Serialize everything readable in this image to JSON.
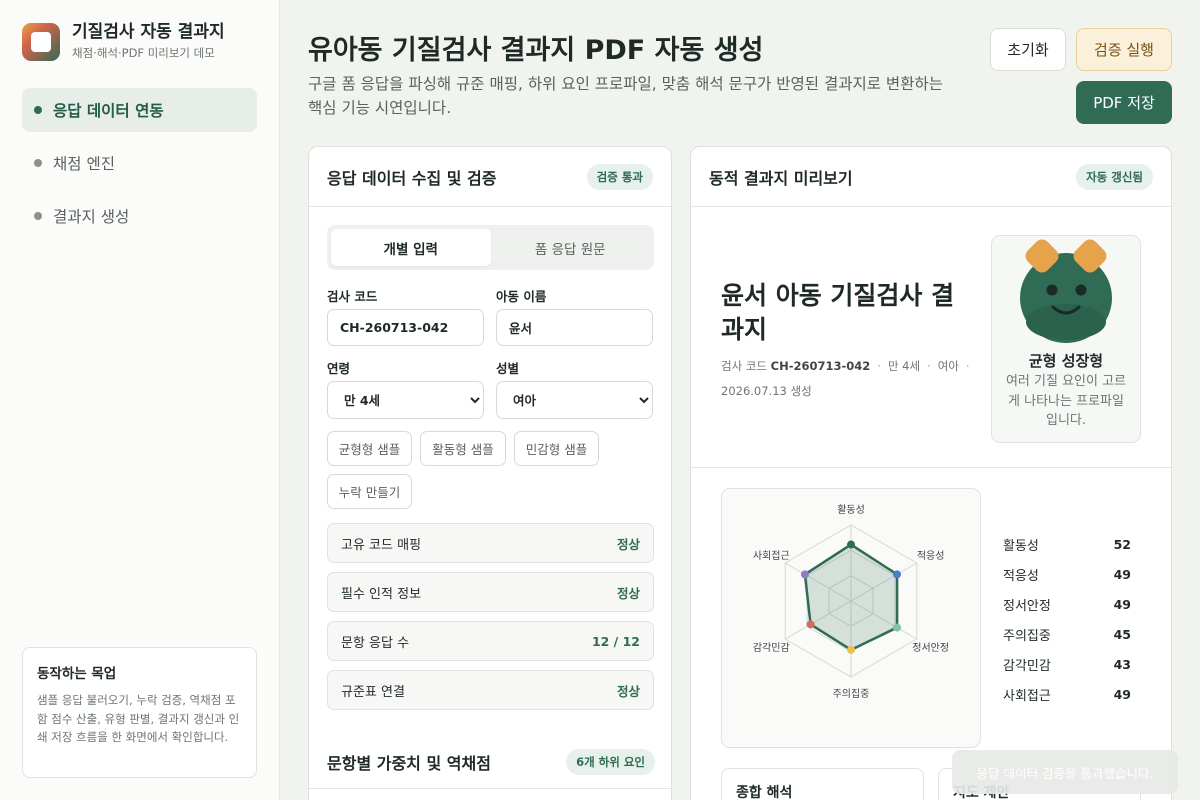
{
  "brand": {
    "title": "기질검사 자동 결과지",
    "subtitle": "채점·해석·PDF 미리보기 데모"
  },
  "nav": [
    {
      "label": "응답 데이터 연동",
      "active": true
    },
    {
      "label": "채점 엔진",
      "active": false
    },
    {
      "label": "결과지 생성",
      "active": false
    }
  ],
  "purpose": {
    "title": "동작하는 목업",
    "body": "샘플 응답 불러오기, 누락 검증, 역채점 포함 점수 산출, 유형 판별, 결과지 갱신과 인쇄 저장 흐름을 한 화면에서 확인합니다."
  },
  "header": {
    "title": "유아동 기질검사 결과지 PDF 자동 생성",
    "description": "구글 폼 응답을 파싱해 규준 매핑, 하위 요인 프로파일, 맞춤 해석 문구가 반영된 결과지로 변환하는 핵심 기능 시연입니다.",
    "reset_label": "초기화",
    "verify_label": "검증 실행",
    "pdf_label": "PDF 저장"
  },
  "left": {
    "title": "응답 데이터 수집 및 검증",
    "badge": "검증 통과",
    "tabs": [
      "개별 입력",
      "폼 응답 원문"
    ],
    "code_label": "검사 코드",
    "code_value": "CH-260713-042",
    "name_label": "아동 이름",
    "name_value": "윤서",
    "age_label": "연령",
    "age_value": "만 4세",
    "gender_label": "성별",
    "gender_value": "여아",
    "samples": [
      "균형형 샘플",
      "활동형 샘플",
      "민감형 샘플",
      "누락 만들기"
    ],
    "checks": [
      {
        "label": "고유 코드 매핑",
        "value": "정상"
      },
      {
        "label": "필수 인적 정보",
        "value": "정상"
      },
      {
        "label": "문항 응답 수",
        "value": "12 / 12"
      },
      {
        "label": "규준표 연결",
        "value": "정상"
      }
    ],
    "weights_title": "문항별 가중치 및 역채점",
    "weights_badge": "6개 하위 요인"
  },
  "right": {
    "title": "동적 결과지 미리보기",
    "badge": "자동 갱신됨",
    "report_title": "윤서 아동 기질검사 결과지",
    "meta_code_label": "검사 코드",
    "meta_code": "CH-260713-042",
    "meta_age": "만 4세",
    "meta_gender": "여아",
    "meta_date": "2026.07.13 생성",
    "profile_title": "균형 성장형",
    "profile_desc": "여러 기질 요인이 고르게 나타나는 프로파일입니다.",
    "summary_title": "종합 해석",
    "guide_title": "지도 제안"
  },
  "chart_data": {
    "type": "radar",
    "categories": [
      "활동성",
      "적응성",
      "정서안정",
      "주의집중",
      "감각민감",
      "사회접근"
    ],
    "values": [
      52,
      49,
      49,
      45,
      43,
      49
    ],
    "range": [
      0,
      70
    ],
    "point_colors": [
      "#2f6b55",
      "#4a7ec9",
      "#7fc4a6",
      "#efbf4a",
      "#d96a5a",
      "#8f7cc4"
    ]
  },
  "toast": "응답 데이터 검증을 통과했습니다."
}
